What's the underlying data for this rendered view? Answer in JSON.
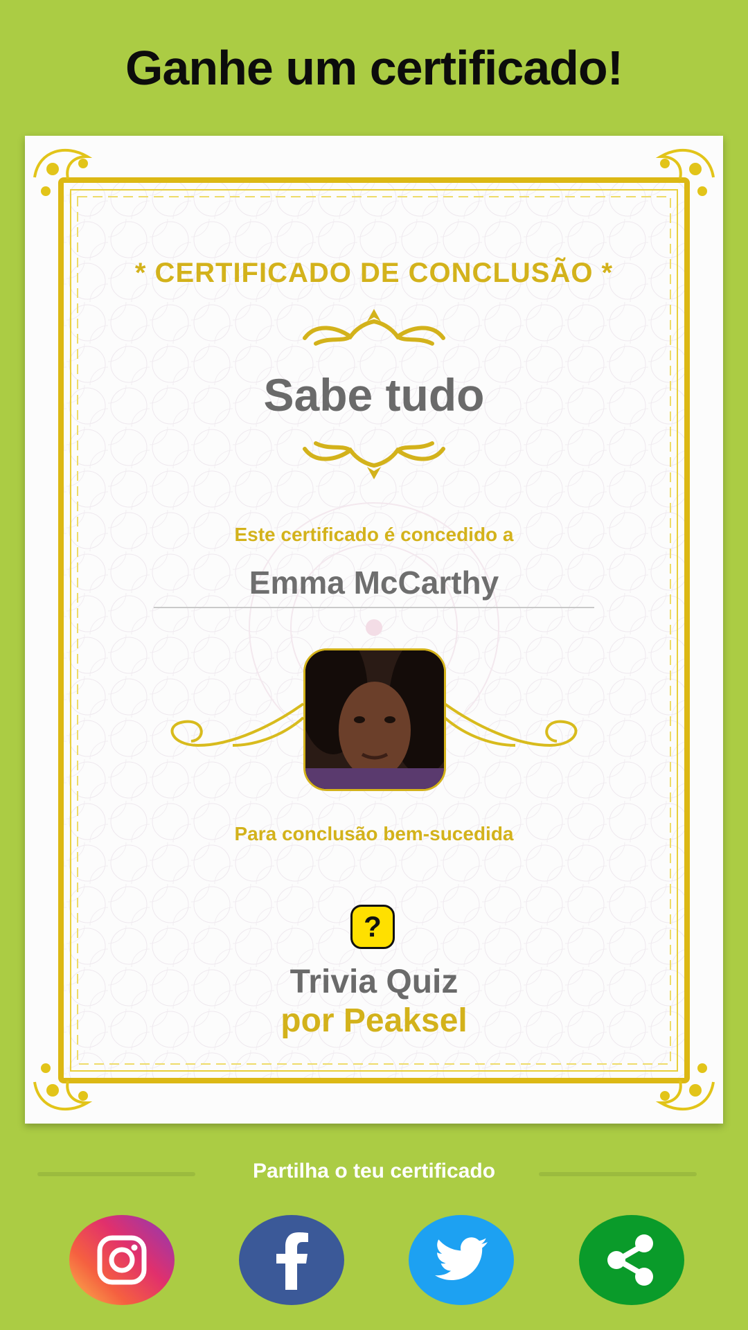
{
  "header": {
    "title": "Ganhe um certificado!"
  },
  "certificate": {
    "heading": "* CERTIFICADO DE CONCLUSÃO *",
    "achievement": "Sabe tudo",
    "awarded_label": "Este certificado é concedido a",
    "recipient_name": "Emma McCarthy",
    "completion_label": "Para conclusão bem-sucedida",
    "app_icon_glyph": "?",
    "app_name": "Trivia Quiz",
    "developer": "por Peaksel",
    "accent_color": "#d3b21b"
  },
  "share": {
    "label": "Partilha o teu certificado",
    "buttons": [
      {
        "name": "instagram",
        "icon": "instagram-icon",
        "color": "#e1306c"
      },
      {
        "name": "facebook",
        "icon": "facebook-icon",
        "color": "#3b5998"
      },
      {
        "name": "twitter",
        "icon": "twitter-icon",
        "color": "#1da1f2"
      },
      {
        "name": "share",
        "icon": "share-icon",
        "color": "#0a9b2a"
      }
    ]
  },
  "colors": {
    "background": "#abcc44"
  }
}
